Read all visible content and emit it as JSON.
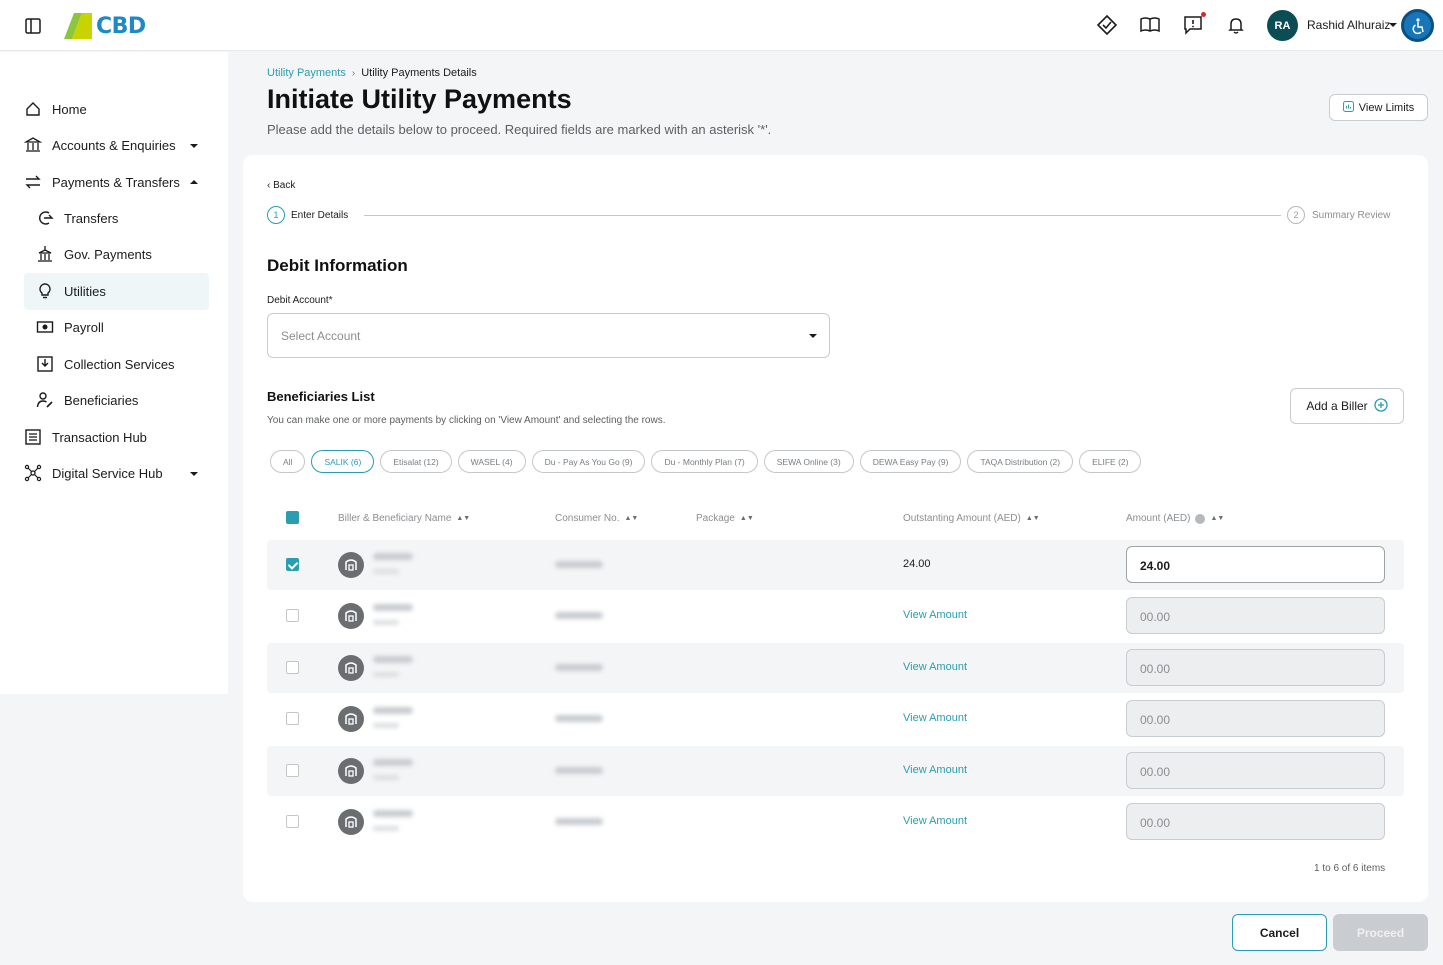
{
  "header": {
    "logo_text": "CBD",
    "user_initials": "RA",
    "user_name": "Rashid Alhuraiz"
  },
  "sidebar": {
    "items": [
      {
        "label": "Home"
      },
      {
        "label": "Accounts & Enquiries"
      },
      {
        "label": "Payments & Transfers"
      },
      {
        "label": "Transfers"
      },
      {
        "label": "Gov. Payments"
      },
      {
        "label": "Utilities"
      },
      {
        "label": "Payroll"
      },
      {
        "label": "Collection Services"
      },
      {
        "label": "Beneficiaries"
      },
      {
        "label": "Transaction Hub"
      },
      {
        "label": "Digital Service Hub"
      }
    ]
  },
  "breadcrumb": {
    "link": "Utility Payments",
    "current": "Utility Payments Details"
  },
  "page": {
    "title": "Initiate Utility Payments",
    "subtitle": "Please add the details below to proceed. Required fields are marked with an asterisk '*'.",
    "view_limits": "View Limits"
  },
  "stepper": {
    "back": "Back",
    "step1_num": "1",
    "step1_label": "Enter Details",
    "step2_num": "2",
    "step2_label": "Summary Review"
  },
  "debit": {
    "title": "Debit Information",
    "label": "Debit Account*",
    "placeholder": "Select Account"
  },
  "beneficiaries": {
    "title": "Beneficiaries List",
    "subtitle": "You can make one or more payments by clicking on 'View Amount' and selecting the rows.",
    "add_biller": "Add a Biller",
    "chips": [
      "All",
      "SALIK (6)",
      "Etisalat (12)",
      "WASEL (4)",
      "Du - Pay As You Go (9)",
      "Du - Monthly Plan (7)",
      "SEWA Online (3)",
      "DEWA Easy Pay (9)",
      "TAQA Distribution (2)",
      "ELIFE (2)"
    ],
    "columns": {
      "name": "Biller & Beneficiary Name",
      "consumer": "Consumer No.",
      "package": "Package",
      "outstanding": "Outstanting Amount (AED)",
      "amount": "Amount (AED)"
    },
    "rows": [
      {
        "outstanding": "24.00",
        "amount": "24.00"
      },
      {
        "outstanding": "View Amount",
        "amount": "00.00"
      },
      {
        "outstanding": "View Amount",
        "amount": "00.00"
      },
      {
        "outstanding": "View Amount",
        "amount": "00.00"
      },
      {
        "outstanding": "View Amount",
        "amount": "00.00"
      },
      {
        "outstanding": "View Amount",
        "amount": "00.00"
      }
    ],
    "pager": "1 to 6 of 6 items"
  },
  "actions": {
    "cancel": "Cancel",
    "proceed": "Proceed"
  },
  "colors": {
    "accent": "#2a9db0",
    "dark_teal": "#0c4d55",
    "disabled": "#c9ccd0"
  }
}
